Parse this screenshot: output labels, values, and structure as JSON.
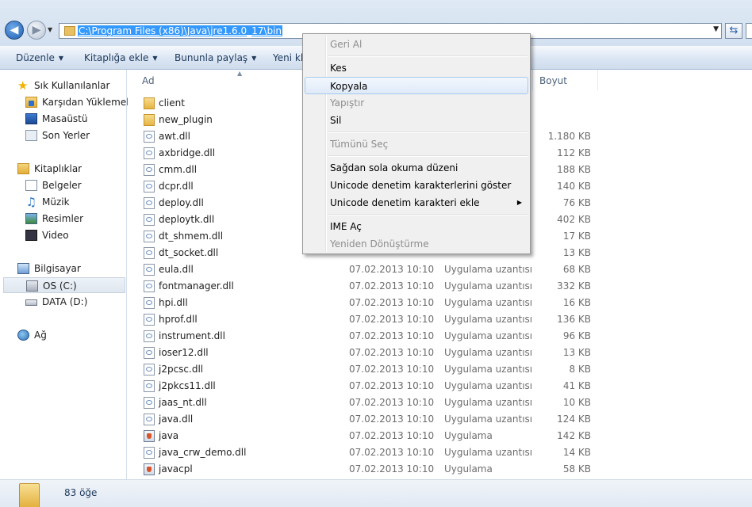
{
  "address": {
    "path": "C:\\Program Files (x86)\\Java\\jre1.6.0_17\\bin"
  },
  "toolbar": {
    "items": [
      {
        "label": "Düzenle"
      },
      {
        "label": "Kitaplığa ekle"
      },
      {
        "label": "Bununla paylaş"
      },
      {
        "label": "Yeni kla"
      }
    ]
  },
  "nav": {
    "favorites": "Sık Kullanılanlar",
    "fav_items": [
      "Karşıdan Yüklemeler",
      "Masaüstü",
      "Son Yerler"
    ],
    "libraries": "Kitaplıklar",
    "lib_items": [
      "Belgeler",
      "Müzik",
      "Resimler",
      "Video"
    ],
    "computer": "Bilgisayar",
    "drives": [
      "OS (C:)",
      "DATA (D:)"
    ],
    "network": "Ağ"
  },
  "columns": {
    "name": "Ad",
    "size": "Boyut"
  },
  "files": [
    {
      "name": "client",
      "date": "",
      "type": "",
      "size": "",
      "kind": "folder"
    },
    {
      "name": "new_plugin",
      "date": "",
      "type": "",
      "size": "",
      "kind": "folder"
    },
    {
      "name": "awt.dll",
      "date": "",
      "type": "",
      "size": "1.180 KB",
      "kind": "dll"
    },
    {
      "name": "axbridge.dll",
      "date": "",
      "type": "",
      "size": "112 KB",
      "kind": "dll"
    },
    {
      "name": "cmm.dll",
      "date": "",
      "type": "",
      "size": "188 KB",
      "kind": "dll"
    },
    {
      "name": "dcpr.dll",
      "date": "",
      "type": "",
      "size": "140 KB",
      "kind": "dll"
    },
    {
      "name": "deploy.dll",
      "date": "",
      "type": "",
      "size": "76 KB",
      "kind": "dll"
    },
    {
      "name": "deploytk.dll",
      "date": "",
      "type": "",
      "size": "402 KB",
      "kind": "dll"
    },
    {
      "name": "dt_shmem.dll",
      "date": "",
      "type": "",
      "size": "17 KB",
      "kind": "dll"
    },
    {
      "name": "dt_socket.dll",
      "date": "",
      "type": "",
      "size": "13 KB",
      "kind": "dll"
    },
    {
      "name": "eula.dll",
      "date": "07.02.2013 10:10",
      "type": "Uygulama uzantısı",
      "size": "68 KB",
      "kind": "dll"
    },
    {
      "name": "fontmanager.dll",
      "date": "07.02.2013 10:10",
      "type": "Uygulama uzantısı",
      "size": "332 KB",
      "kind": "dll"
    },
    {
      "name": "hpi.dll",
      "date": "07.02.2013 10:10",
      "type": "Uygulama uzantısı",
      "size": "16 KB",
      "kind": "dll"
    },
    {
      "name": "hprof.dll",
      "date": "07.02.2013 10:10",
      "type": "Uygulama uzantısı",
      "size": "136 KB",
      "kind": "dll"
    },
    {
      "name": "instrument.dll",
      "date": "07.02.2013 10:10",
      "type": "Uygulama uzantısı",
      "size": "96 KB",
      "kind": "dll"
    },
    {
      "name": "ioser12.dll",
      "date": "07.02.2013 10:10",
      "type": "Uygulama uzantısı",
      "size": "13 KB",
      "kind": "dll"
    },
    {
      "name": "j2pcsc.dll",
      "date": "07.02.2013 10:10",
      "type": "Uygulama uzantısı",
      "size": "8 KB",
      "kind": "dll"
    },
    {
      "name": "j2pkcs11.dll",
      "date": "07.02.2013 10:10",
      "type": "Uygulama uzantısı",
      "size": "41 KB",
      "kind": "dll"
    },
    {
      "name": "jaas_nt.dll",
      "date": "07.02.2013 10:10",
      "type": "Uygulama uzantısı",
      "size": "10 KB",
      "kind": "dll"
    },
    {
      "name": "java.dll",
      "date": "07.02.2013 10:10",
      "type": "Uygulama uzantısı",
      "size": "124 KB",
      "kind": "dll"
    },
    {
      "name": "java",
      "date": "07.02.2013 10:10",
      "type": "Uygulama",
      "size": "142 KB",
      "kind": "app"
    },
    {
      "name": "java_crw_demo.dll",
      "date": "07.02.2013 10:10",
      "type": "Uygulama uzantısı",
      "size": "14 KB",
      "kind": "dll"
    },
    {
      "name": "javacpl",
      "date": "07.02.2013 10:10",
      "type": "Uygulama",
      "size": "58 KB",
      "kind": "app"
    }
  ],
  "status": {
    "count": "83 öğe"
  },
  "context_menu": {
    "items": [
      {
        "label": "Geri Al",
        "disabled": true
      },
      {
        "label": "Kes",
        "disabled": false
      },
      {
        "label": "Kopyala",
        "disabled": false,
        "highlighted": true
      },
      {
        "label": "Yapıştır",
        "disabled": true
      },
      {
        "label": "Sil",
        "disabled": false
      },
      {
        "label": "Tümünü Seç",
        "disabled": true
      },
      {
        "label": "Sağdan sola okuma düzeni",
        "disabled": false
      },
      {
        "label": "Unicode denetim karakterlerini göster",
        "disabled": false
      },
      {
        "label": "Unicode denetim karakteri ekle",
        "disabled": false,
        "submenu": true
      },
      {
        "label": "IME Aç",
        "disabled": false
      },
      {
        "label": "Yeniden Dönüştürme",
        "disabled": true
      }
    ]
  },
  "colors": {
    "selection": "#3399ff",
    "toolbar_text": "#1e395b",
    "disabled_text": "#8d8d8d"
  }
}
